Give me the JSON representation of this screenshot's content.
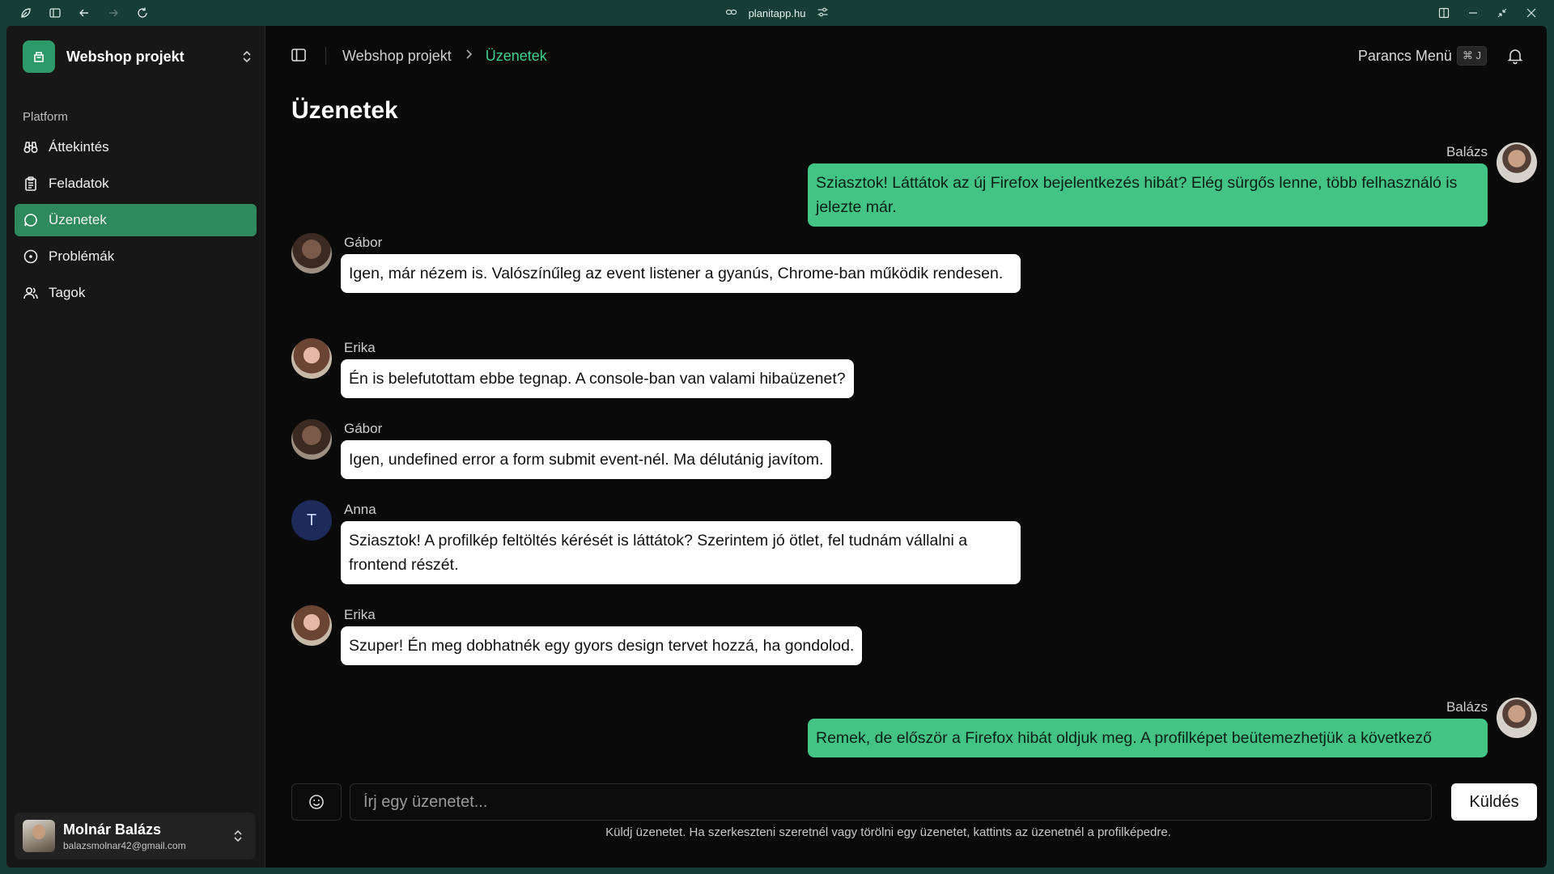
{
  "browser": {
    "url": "planitapp.hu",
    "icons": [
      "leaf-icon",
      "sidebar-icon",
      "back-icon",
      "forward-icon",
      "reload-icon",
      "link-icon",
      "tune-icon",
      "panel-icon",
      "minimize-icon",
      "restore-icon",
      "close-icon"
    ]
  },
  "workspace": {
    "name": "Webshop projekt"
  },
  "sidebar": {
    "group_label": "Platform",
    "items": [
      {
        "label": "Áttekintés",
        "icon": "binoculars-icon",
        "active": false
      },
      {
        "label": "Feladatok",
        "icon": "clipboard-icon",
        "active": false
      },
      {
        "label": "Üzenetek",
        "icon": "message-circle-icon",
        "active": true
      },
      {
        "label": "Problémák",
        "icon": "circle-dot-icon",
        "active": false
      },
      {
        "label": "Tagok",
        "icon": "users-icon",
        "active": false
      }
    ]
  },
  "user": {
    "name": "Molnár Balázs",
    "email": "balazsmolnar42@gmail.com"
  },
  "header": {
    "breadcrumb_root": "Webshop projekt",
    "breadcrumb_current": "Üzenetek",
    "command_menu": "Parancs Menü",
    "shortcut": "⌘ J"
  },
  "page": {
    "title": "Üzenetek"
  },
  "messages": [
    {
      "author": "Balázs",
      "outgoing": true,
      "text": "Sziasztok! Láttátok az új Firefox bejelentkezés hibát? Elég sürgős lenne, több felhasználó is jelezte már."
    },
    {
      "author": "Gábor",
      "outgoing": false,
      "text": "Igen, már nézem is. Valószínűleg az event listener a gyanús, Chrome-ban működik rendesen."
    },
    {
      "author": "Erika",
      "outgoing": false,
      "text": "Én is belefutottam ebbe tegnap. A console-ban van valami hibaüzenet?"
    },
    {
      "author": "Gábor",
      "outgoing": false,
      "text": "Igen, undefined error a form submit event-nél. Ma délutánig javítom."
    },
    {
      "author": "Anna",
      "outgoing": false,
      "avatar_letter": "T",
      "text": "Sziasztok! A profilkép feltöltés kérését is láttátok? Szerintem jó ötlet, fel tudnám vállalni a frontend részét."
    },
    {
      "author": "Erika",
      "outgoing": false,
      "text": "Szuper! Én meg dobhatnék egy gyors design tervet hozzá, ha gondolod."
    },
    {
      "author": "Balázs",
      "outgoing": true,
      "text": "Remek, de először a Firefox hibát oldjuk meg. A profilképet beütemezhetjük a következő"
    }
  ],
  "composer": {
    "placeholder": "Írj egy üzenetet...",
    "send_label": "Küldés",
    "hint": "Küldj üzenetet. Ha szerkeszteni szeretnél vagy törölni egy üzenetet, kattints az üzenetnél a profilképedre."
  },
  "colors": {
    "accent": "#3ecf8e",
    "active_nav": "#2e8a5c",
    "outgoing_bubble": "#43c485",
    "frame": "#163d36"
  }
}
